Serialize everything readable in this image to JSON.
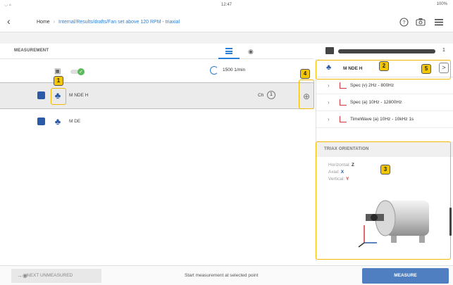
{
  "status": {
    "time": "12:47",
    "battery": "100%"
  },
  "nav": {
    "home": "Home",
    "path": "Internal/Results/drafts/Fan set above 120 RPM - triaxial"
  },
  "measurement": {
    "header": "MEASUREMENT",
    "speed": "1500 1/min",
    "points": [
      {
        "name": "M NDE H",
        "channel_label": "Ch",
        "channel": "1"
      },
      {
        "name": "M DE"
      }
    ]
  },
  "progress": {
    "count": "1",
    "fraction": 0.95
  },
  "panel": {
    "point_name": "M NDE H",
    "measurements": [
      "Spec (v) 2Hz - 800Hz",
      "Spec (a) 10Hz - 12800Hz",
      "TimeWave (a) 10Hz - 10kHz 1s"
    ],
    "triax": {
      "title": "TRIAX ORIENTATION",
      "horizontal_label": "Horizontal:",
      "horizontal": "Z",
      "axial_label": "Axial:",
      "axial": "X",
      "vertical_label": "Vertical:",
      "vertical": "Y"
    }
  },
  "callouts": [
    "1",
    "2",
    "3",
    "4",
    "5"
  ],
  "bottom": {
    "next": "NEXT UNMEASURED",
    "hint": "Start measurement at selected point",
    "measure": "MEASURE"
  },
  "colors": {
    "accent": "#2a7fd6",
    "callout": "#f2c600",
    "measure_button": "#4f7fc0"
  }
}
